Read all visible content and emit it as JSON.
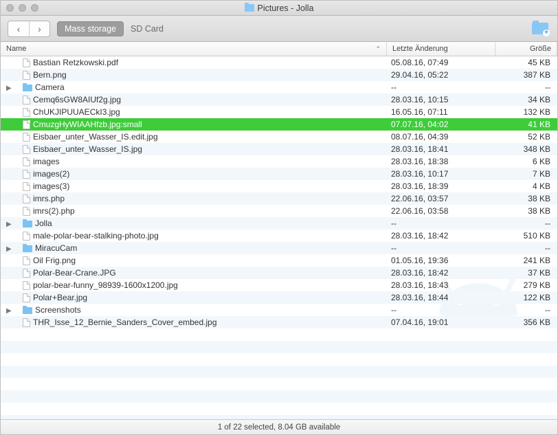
{
  "window": {
    "title": "Pictures - Jolla"
  },
  "toolbar": {
    "mass_storage": "Mass storage",
    "sd_card": "SD Card"
  },
  "columns": {
    "name": "Name",
    "date": "Letzte Änderung",
    "size": "Größe"
  },
  "rows": [
    {
      "kind": "file",
      "name": "Bastian Retzkowski.pdf",
      "date": "05.08.16, 07:49",
      "size": "45 KB"
    },
    {
      "kind": "file",
      "name": "Bern.png",
      "date": "29.04.16, 05:22",
      "size": "387 KB"
    },
    {
      "kind": "folder",
      "name": "Camera",
      "date": "--",
      "size": "--"
    },
    {
      "kind": "file",
      "name": "Cemq6sGW8AIUf2g.jpg",
      "date": "28.03.16, 10:15",
      "size": "34 KB"
    },
    {
      "kind": "file",
      "name": "ChUKJIPUUAECkI3.jpg",
      "date": "16.05.16, 07:11",
      "size": "132 KB"
    },
    {
      "kind": "file",
      "name": "CmuzgHyWIAAHfzb.jpg:small",
      "date": "07.07.16, 04:02",
      "size": "41 KB",
      "selected": true
    },
    {
      "kind": "file",
      "name": "Eisbaer_unter_Wasser_IS.edit.jpg",
      "date": "08.07.16, 04:39",
      "size": "52 KB"
    },
    {
      "kind": "file",
      "name": "Eisbaer_unter_Wasser_IS.jpg",
      "date": "28.03.16, 18:41",
      "size": "348 KB"
    },
    {
      "kind": "file",
      "name": "images",
      "date": "28.03.16, 18:38",
      "size": "6 KB"
    },
    {
      "kind": "file",
      "name": "images(2)",
      "date": "28.03.16, 10:17",
      "size": "7 KB"
    },
    {
      "kind": "file",
      "name": "images(3)",
      "date": "28.03.16, 18:39",
      "size": "4 KB"
    },
    {
      "kind": "file",
      "name": "imrs.php",
      "date": "22.06.16, 03:57",
      "size": "38 KB"
    },
    {
      "kind": "file",
      "name": "imrs(2).php",
      "date": "22.06.16, 03:58",
      "size": "38 KB"
    },
    {
      "kind": "folder",
      "name": "Jolla",
      "date": "--",
      "size": "--"
    },
    {
      "kind": "file",
      "name": "male-polar-bear-stalking-photo.jpg",
      "date": "28.03.16, 18:42",
      "size": "510 KB"
    },
    {
      "kind": "folder",
      "name": "MiracuCam",
      "date": "--",
      "size": "--"
    },
    {
      "kind": "file",
      "name": "Oil Frig.png",
      "date": "01.05.16, 19:36",
      "size": "241 KB"
    },
    {
      "kind": "file",
      "name": "Polar-Bear-Crane.JPG",
      "date": "28.03.16, 18:42",
      "size": "37 KB"
    },
    {
      "kind": "file",
      "name": "polar-bear-funny_98939-1600x1200.jpg",
      "date": "28.03.16, 18:43",
      "size": "279 KB"
    },
    {
      "kind": "file",
      "name": "Polar+Bear.jpg",
      "date": "28.03.16, 18:44",
      "size": "122 KB"
    },
    {
      "kind": "folder",
      "name": "Screenshots",
      "date": "--",
      "size": "--"
    },
    {
      "kind": "file",
      "name": "THR_Isse_12_Bernie_Sanders_Cover_embed.jpg",
      "date": "07.04.16, 19:01",
      "size": "356 KB"
    }
  ],
  "status": "1 of 22 selected, 8.04 GB available"
}
